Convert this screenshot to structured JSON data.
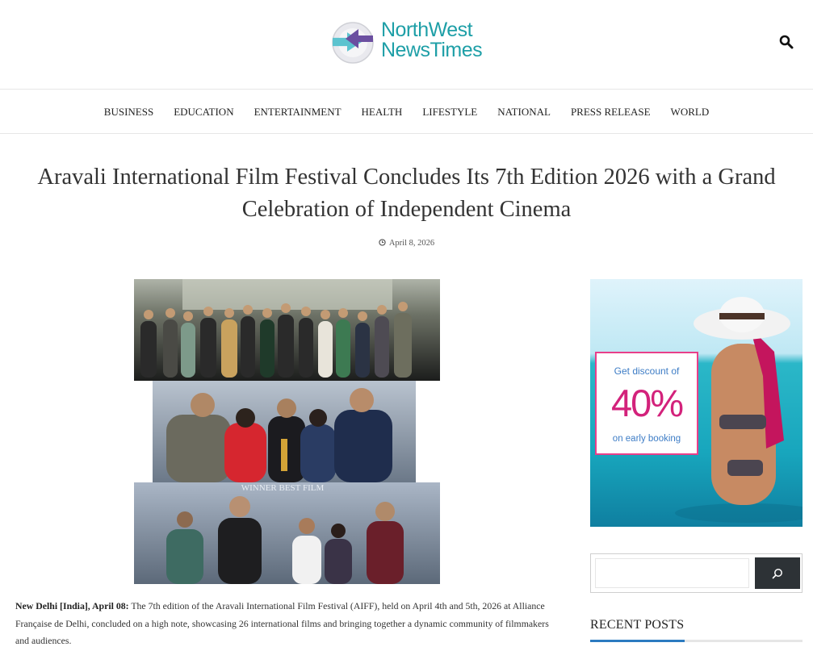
{
  "site": {
    "logo_line1": "NorthWest",
    "logo_line2": "NewsTimes",
    "brand_color": "#1e9fa7",
    "accent_purple": "#6b4fa0"
  },
  "header": {
    "search_icon": "search-icon"
  },
  "nav": {
    "items": [
      "BUSINESS",
      "EDUCATION",
      "ENTERTAINMENT",
      "HEALTH",
      "LIFESTYLE",
      "NATIONAL",
      "PRESS RELEASE",
      "WORLD"
    ]
  },
  "article": {
    "title": "Aravali International Film Festival Concludes Its 7th Edition 2026 with a Grand Celebration of Independent Cinema",
    "date": "April 8, 2026",
    "dateline": "New Delhi [India], April 08:",
    "body": " The 7th edition of the Aravali International Film Festival (AIFF), held on April 4th and 5th, 2026 at Alliance Française de Delhi, concluded on a high note, showcasing 26 international films and bringing together a dynamic community of filmmakers and audiences.",
    "image_banner_text": "WINNER   BEST FILM"
  },
  "sidebar": {
    "ad": {
      "line1": "Get discount of",
      "line2": "40%",
      "line3": "on early booking",
      "pink": "#d3227b",
      "blue": "#3e7dc6"
    },
    "search": {
      "placeholder": "",
      "button_icon": "search-icon"
    },
    "recent_posts_title": "RECENT POSTS",
    "accent_blue": "#2c7bc0"
  }
}
